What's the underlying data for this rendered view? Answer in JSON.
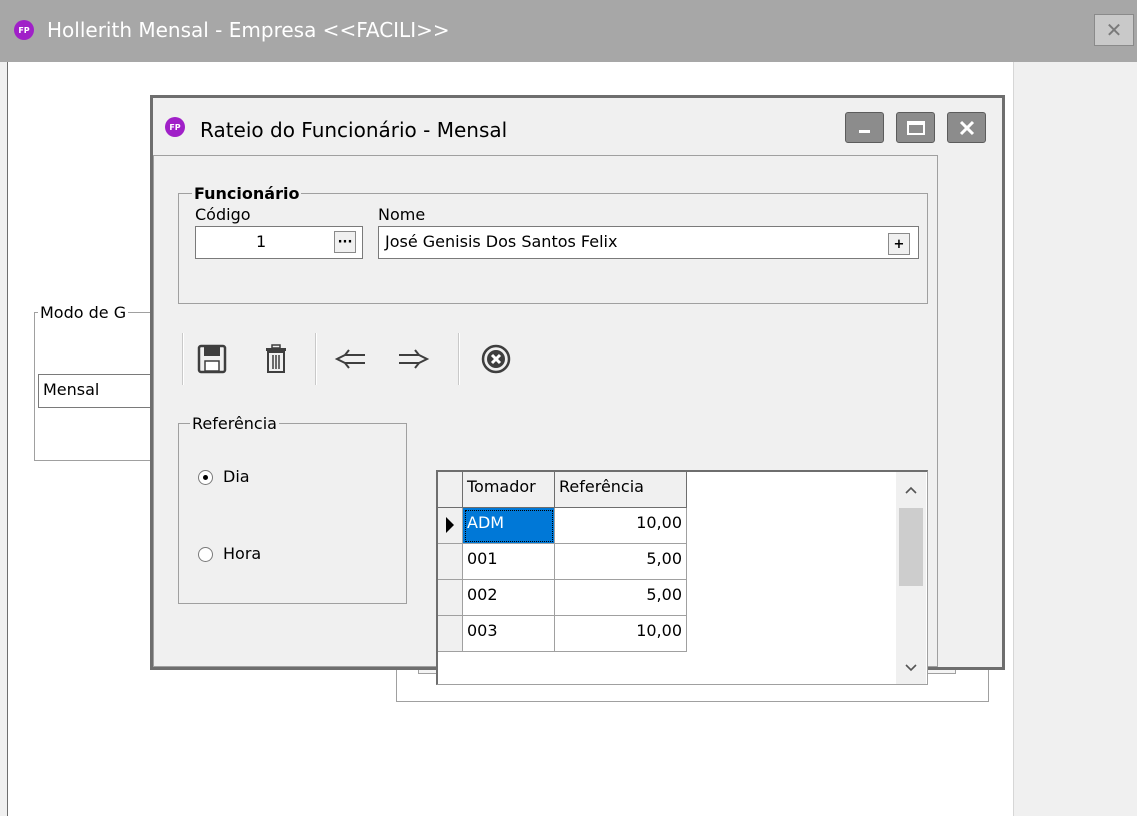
{
  "outer_window": {
    "title": "Hollerith Mensal - Empresa <<FACILI>>",
    "logo_text": "FP",
    "close_icon": "close-icon",
    "group_label": "Modo de G",
    "field_value": "Mensal"
  },
  "dialog": {
    "title": "Rateio do Funcionário - Mensal",
    "logo_text": "FP",
    "minimize_icon": "minimize-icon",
    "maximize_icon": "maximize-icon",
    "close_icon": "close-icon",
    "funcionario": {
      "group_label": "Funcionário",
      "codigo_label": "Código",
      "codigo_value": "1",
      "ellipsis_label": "···",
      "nome_label": "Nome",
      "nome_value": "José Genisis Dos Santos Felix",
      "plus_label": "+"
    },
    "toolbar": [
      {
        "name": "save-button",
        "icon": "floppy-disk-icon"
      },
      {
        "name": "delete-button",
        "icon": "trash-icon"
      },
      {
        "name": "previous-button",
        "icon": "arrow-left-icon"
      },
      {
        "name": "next-button",
        "icon": "arrow-right-icon"
      },
      {
        "name": "cancel-button",
        "icon": "cancel-circle-icon"
      }
    ],
    "referencia": {
      "group_label": "Referência",
      "options": [
        {
          "label": "Dia",
          "checked": true
        },
        {
          "label": "Hora",
          "checked": false
        }
      ]
    },
    "grid": {
      "columns": [
        "Tomador",
        "Referência"
      ],
      "rows": [
        {
          "tomador": "ADM",
          "referencia": "10,00",
          "current": true
        },
        {
          "tomador": "001",
          "referencia": "5,00",
          "current": false
        },
        {
          "tomador": "002",
          "referencia": "5,00",
          "current": false
        },
        {
          "tomador": "003",
          "referencia": "10,00",
          "current": false
        }
      ],
      "scroll_up_icon": "chevron-up-icon",
      "scroll_down_icon": "chevron-down-icon"
    }
  },
  "colors": {
    "title_inactive": "#a7a7a7",
    "accent_logo": "#a020c8",
    "selection": "#0078d7"
  }
}
